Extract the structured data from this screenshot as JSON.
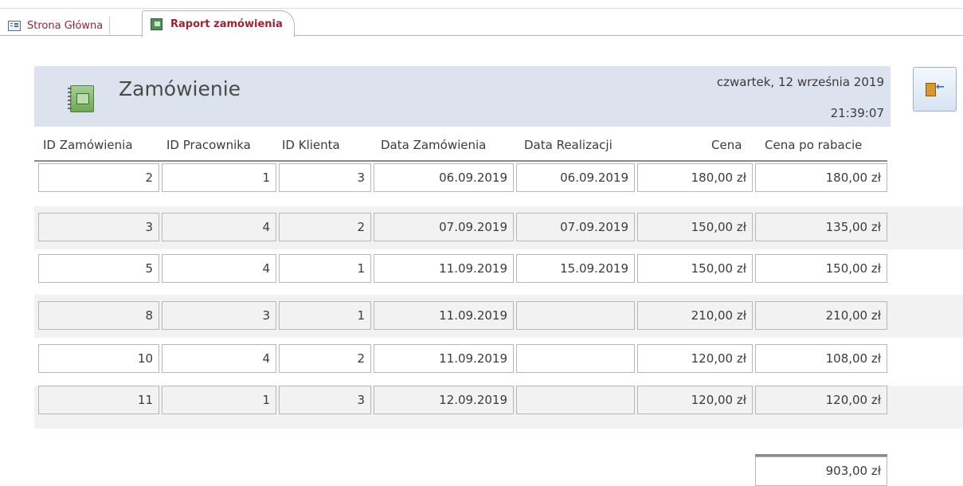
{
  "tabs": [
    {
      "label": "Strona Główna",
      "icon": "form-icon"
    },
    {
      "label": "Raport zamówienia",
      "icon": "report-icon"
    }
  ],
  "header": {
    "title": "Zamówienie",
    "date": "czwartek, 12 września 2019",
    "time": "21:39:07",
    "close_icon": "exit-door-icon"
  },
  "columns": [
    "ID Zamówienia",
    "ID Pracownika",
    "ID Klienta",
    "Data Zamówienia",
    "Data Realizacji",
    "Cena",
    "Cena po rabacie"
  ],
  "rows": [
    {
      "c0": "2",
      "c1": "1",
      "c2": "3",
      "c3": "06.09.2019",
      "c4": "06.09.2019",
      "c5": "180,00 zł",
      "c6": "180,00 zł"
    },
    {
      "c0": "3",
      "c1": "4",
      "c2": "2",
      "c3": "07.09.2019",
      "c4": "07.09.2019",
      "c5": "150,00 zł",
      "c6": "135,00 zł"
    },
    {
      "c0": "5",
      "c1": "4",
      "c2": "1",
      "c3": "11.09.2019",
      "c4": "15.09.2019",
      "c5": "150,00 zł",
      "c6": "150,00 zł"
    },
    {
      "c0": "8",
      "c1": "3",
      "c2": "1",
      "c3": "11.09.2019",
      "c4": "",
      "c5": "210,00 zł",
      "c6": "210,00 zł"
    },
    {
      "c0": "10",
      "c1": "4",
      "c2": "2",
      "c3": "11.09.2019",
      "c4": "",
      "c5": "120,00 zł",
      "c6": "108,00 zł"
    },
    {
      "c0": "11",
      "c1": "1",
      "c2": "3",
      "c3": "12.09.2019",
      "c4": "",
      "c5": "120,00 zł",
      "c6": "120,00 zł"
    }
  ],
  "total": "903,00 zł",
  "colors": {
    "accent": "#9b2335",
    "header_bg": "#dce3ee",
    "alt_row": "#f2f2f2"
  }
}
